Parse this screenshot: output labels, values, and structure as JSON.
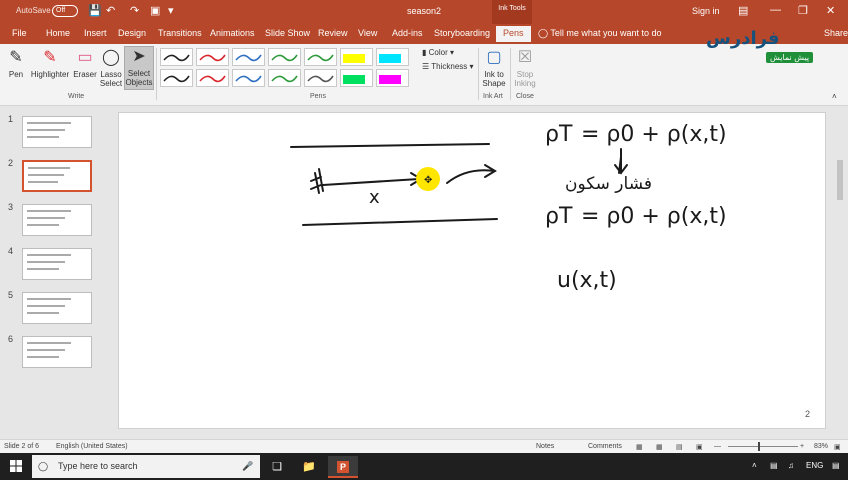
{
  "titlebar": {
    "autosave_label": "AutoSave",
    "autosave_state": "Off",
    "document_title": "season2",
    "contextual_tab_group": "Ink Tools",
    "signin": "Sign in"
  },
  "tabs": [
    "File",
    "Home",
    "Insert",
    "Design",
    "Transitions",
    "Animations",
    "Slide Show",
    "Review",
    "View",
    "Add-ins",
    "Storyboarding",
    "Pens"
  ],
  "active_tab": "Pens",
  "tell_me": "Tell me what you want to do",
  "share": "Share",
  "ribbon": {
    "write_group": {
      "label": "Write",
      "buttons": [
        "Pen",
        "Highlighter",
        "Eraser",
        "Lasso Select",
        "Select Objects"
      ]
    },
    "pens_group": {
      "label": "Pens"
    },
    "color_label": "Color",
    "thickness_label": "Thickness",
    "inkart_group": {
      "label": "Ink Art",
      "button": "Ink to Shape"
    },
    "close_group": {
      "label": "Close",
      "button": "Stop Inking"
    }
  },
  "pens": [
    {
      "color": "#222222"
    },
    {
      "color": "#d9262c"
    },
    {
      "color": "#2f6fc1"
    },
    {
      "color": "#2e9a3c"
    },
    {
      "color": "#2e9a3c"
    },
    {
      "color": "#ffff00"
    },
    {
      "color": "#00e5ff"
    },
    {
      "color": "#222222"
    },
    {
      "color": "#d9262c"
    },
    {
      "color": "#2f6fc1"
    },
    {
      "color": "#2e9a3c"
    },
    {
      "color": "#555555"
    },
    {
      "color": "#00e060"
    },
    {
      "color": "#ff00ff"
    }
  ],
  "thumbnails": [
    {
      "number": "1",
      "selected": false
    },
    {
      "number": "2",
      "selected": true
    },
    {
      "number": "3",
      "selected": false
    },
    {
      "number": "4",
      "selected": false
    },
    {
      "number": "5",
      "selected": false
    },
    {
      "number": "6",
      "selected": false
    }
  ],
  "slide": {
    "page_number": "2",
    "ink_text": {
      "var_x": "x",
      "eq1_rho_t": "ρT",
      "eq1_rhs": "= ρ0 + ρ(x,t)",
      "persian_note": "فشار سکون",
      "eq2_rho_t": "ρT",
      "eq2_rhs": "= ρ0 + ρ(x,t)",
      "u_expr": "u(x,t)"
    },
    "highlight_color": "#ffe600"
  },
  "statusbar": {
    "slide_of": "Slide 2 of 6",
    "language": "English (United States)",
    "notes": "Notes",
    "comments": "Comments",
    "zoom": "83%"
  },
  "taskbar": {
    "search_placeholder": "Type here to search",
    "language": "ENG"
  },
  "logo": {
    "main": "فرادرس",
    "sub": "پیش نمایش"
  }
}
